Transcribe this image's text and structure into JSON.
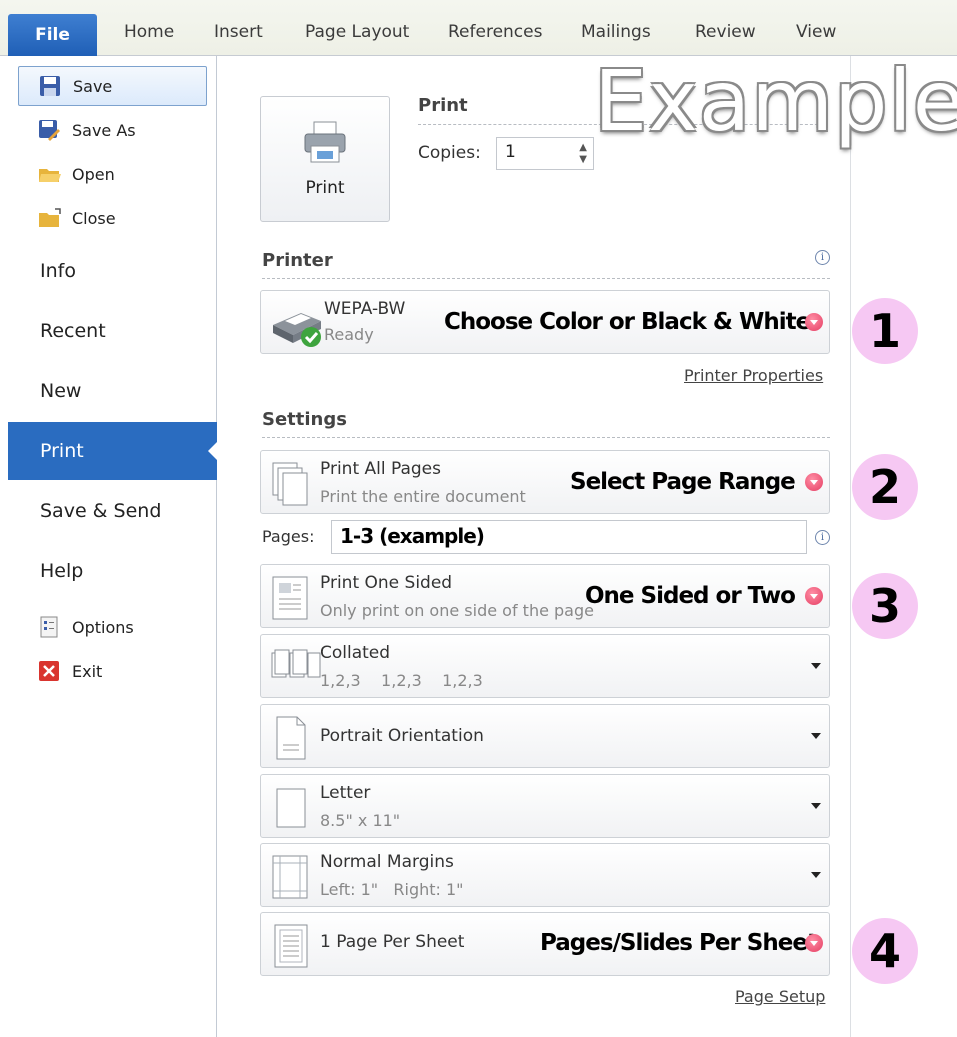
{
  "ribbon": {
    "tabs": [
      "File",
      "Home",
      "Insert",
      "Page Layout",
      "References",
      "Mailings",
      "Review",
      "View"
    ]
  },
  "nav": {
    "small_top": [
      {
        "label": "Save",
        "icon": "save-icon"
      },
      {
        "label": "Save As",
        "icon": "save-as-icon"
      },
      {
        "label": "Open",
        "icon": "open-folder-icon"
      },
      {
        "label": "Close",
        "icon": "close-folder-icon"
      }
    ],
    "big": [
      "Info",
      "Recent",
      "New",
      "Print",
      "Save & Send",
      "Help"
    ],
    "active": "Print",
    "small_bottom": [
      {
        "label": "Options",
        "icon": "options-icon"
      },
      {
        "label": "Exit",
        "icon": "exit-icon"
      }
    ]
  },
  "print": {
    "button_label": "Print",
    "section_title": "Print",
    "copies_label": "Copies:",
    "copies_value": "1"
  },
  "printer": {
    "section_title": "Printer",
    "name": "WEPA-BW",
    "status": "Ready",
    "properties_link": "Printer Properties"
  },
  "settings": {
    "section_title": "Settings",
    "page_range": {
      "title": "Print All Pages",
      "subtitle": "Print the entire document"
    },
    "pages_label": "Pages:",
    "pages_value": "1-3 (example)",
    "sides": {
      "title": "Print One Sided",
      "subtitle": "Only print on one side of the page"
    },
    "collation": {
      "title": "Collated",
      "subtitle": "1,2,3    1,2,3    1,2,3"
    },
    "orientation": {
      "title": "Portrait Orientation"
    },
    "paper": {
      "title": "Letter",
      "subtitle": "8.5\" x 11\""
    },
    "margins": {
      "title": "Normal Margins",
      "subtitle": "Left: 1\"   Right: 1\""
    },
    "per_sheet": {
      "title": "1 Page Per Sheet"
    },
    "page_setup_link": "Page Setup"
  },
  "annotations": {
    "watermark": "Example",
    "callouts": [
      {
        "num": "1",
        "text": "Choose Color or Black & White"
      },
      {
        "num": "2",
        "text": "Select Page Range"
      },
      {
        "num": "3",
        "text": "One Sided or Two"
      },
      {
        "num": "4",
        "text": "Pages/Slides Per Sheet"
      }
    ],
    "badge_color": "#f6c8f3"
  },
  "colors": {
    "accent": "#2a6cc0",
    "file_tab": "#2a6cc0"
  }
}
